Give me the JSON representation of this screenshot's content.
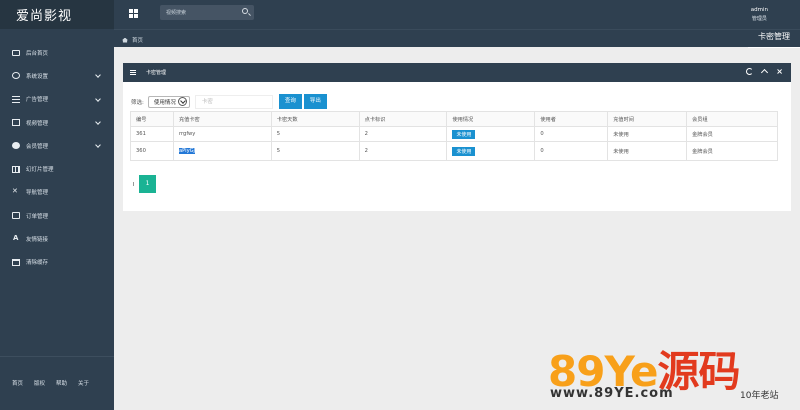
{
  "brand": {
    "title": "爱尚影视"
  },
  "header": {
    "search_placeholder": "视频搜索",
    "user_name": "admin",
    "user_role": "管理员"
  },
  "sidebar": {
    "items": [
      {
        "label": "后台首页",
        "icon": "monitor-icon"
      },
      {
        "label": "系统设置",
        "icon": "gear-icon",
        "expandable": true
      },
      {
        "label": "广告管理",
        "icon": "list-icon",
        "expandable": true
      },
      {
        "label": "视频管理",
        "icon": "film-icon",
        "expandable": true
      },
      {
        "label": "会员管理",
        "icon": "user-circle-icon",
        "expandable": true
      },
      {
        "label": "幻灯片管理",
        "icon": "table-icon"
      },
      {
        "label": "导航管理",
        "icon": "shuffle-icon"
      },
      {
        "label": "订单管理",
        "icon": "card-icon"
      },
      {
        "label": "友情链接",
        "icon": "text-icon"
      },
      {
        "label": "清除缓存",
        "icon": "calendar-icon"
      }
    ],
    "footer": [
      "首页",
      "版权",
      "帮助",
      "关于"
    ]
  },
  "breadcrumb": {
    "home": "首页",
    "tab": "卡密管理"
  },
  "panel": {
    "title": "卡密管理",
    "filter_label": "筛选:",
    "filter_value": "使用情况",
    "keyword_placeholder": "卡密",
    "search_button": "查询",
    "export_button": "导出",
    "columns": [
      "编号",
      "充值卡密",
      "卡密天数",
      "点卡标识",
      "使用情况",
      "使用者",
      "充值时间",
      "会员组"
    ],
    "rows": [
      [
        "361",
        "rrgfwy",
        "5",
        "2",
        "未使用",
        "0",
        "未使用",
        "金牌会员"
      ],
      [
        "360",
        "aPiyGJ",
        "5",
        "2",
        "未使用",
        "0",
        "未使用",
        "金牌会员"
      ]
    ],
    "page": "1"
  },
  "watermark": {
    "brand_a": "89",
    "brand_b": "Y",
    "brand_c": "e",
    "brand_cn": "源码",
    "url": "www.89YE.com",
    "tagline": "10年老站"
  },
  "colors": {
    "sidebar": "#2f4050",
    "accent": "#1a91d0",
    "pager": "#1ab394"
  }
}
